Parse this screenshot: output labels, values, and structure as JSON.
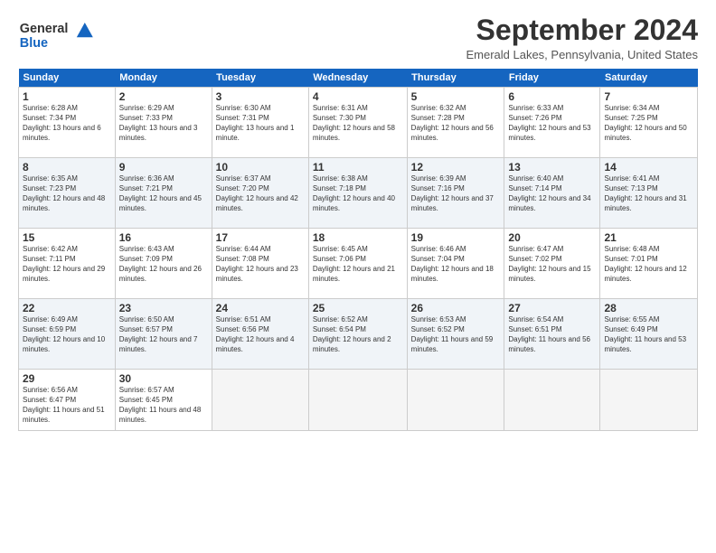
{
  "header": {
    "logo_general": "General",
    "logo_blue": "Blue",
    "title": "September 2024",
    "location": "Emerald Lakes, Pennsylvania, United States"
  },
  "days_of_week": [
    "Sunday",
    "Monday",
    "Tuesday",
    "Wednesday",
    "Thursday",
    "Friday",
    "Saturday"
  ],
  "weeks": [
    [
      {
        "num": "1",
        "sunrise": "6:28 AM",
        "sunset": "7:34 PM",
        "daylight": "13 hours and 6 minutes."
      },
      {
        "num": "2",
        "sunrise": "6:29 AM",
        "sunset": "7:33 PM",
        "daylight": "13 hours and 3 minutes."
      },
      {
        "num": "3",
        "sunrise": "6:30 AM",
        "sunset": "7:31 PM",
        "daylight": "13 hours and 1 minute."
      },
      {
        "num": "4",
        "sunrise": "6:31 AM",
        "sunset": "7:30 PM",
        "daylight": "12 hours and 58 minutes."
      },
      {
        "num": "5",
        "sunrise": "6:32 AM",
        "sunset": "7:28 PM",
        "daylight": "12 hours and 56 minutes."
      },
      {
        "num": "6",
        "sunrise": "6:33 AM",
        "sunset": "7:26 PM",
        "daylight": "12 hours and 53 minutes."
      },
      {
        "num": "7",
        "sunrise": "6:34 AM",
        "sunset": "7:25 PM",
        "daylight": "12 hours and 50 minutes."
      }
    ],
    [
      {
        "num": "8",
        "sunrise": "6:35 AM",
        "sunset": "7:23 PM",
        "daylight": "12 hours and 48 minutes."
      },
      {
        "num": "9",
        "sunrise": "6:36 AM",
        "sunset": "7:21 PM",
        "daylight": "12 hours and 45 minutes."
      },
      {
        "num": "10",
        "sunrise": "6:37 AM",
        "sunset": "7:20 PM",
        "daylight": "12 hours and 42 minutes."
      },
      {
        "num": "11",
        "sunrise": "6:38 AM",
        "sunset": "7:18 PM",
        "daylight": "12 hours and 40 minutes."
      },
      {
        "num": "12",
        "sunrise": "6:39 AM",
        "sunset": "7:16 PM",
        "daylight": "12 hours and 37 minutes."
      },
      {
        "num": "13",
        "sunrise": "6:40 AM",
        "sunset": "7:14 PM",
        "daylight": "12 hours and 34 minutes."
      },
      {
        "num": "14",
        "sunrise": "6:41 AM",
        "sunset": "7:13 PM",
        "daylight": "12 hours and 31 minutes."
      }
    ],
    [
      {
        "num": "15",
        "sunrise": "6:42 AM",
        "sunset": "7:11 PM",
        "daylight": "12 hours and 29 minutes."
      },
      {
        "num": "16",
        "sunrise": "6:43 AM",
        "sunset": "7:09 PM",
        "daylight": "12 hours and 26 minutes."
      },
      {
        "num": "17",
        "sunrise": "6:44 AM",
        "sunset": "7:08 PM",
        "daylight": "12 hours and 23 minutes."
      },
      {
        "num": "18",
        "sunrise": "6:45 AM",
        "sunset": "7:06 PM",
        "daylight": "12 hours and 21 minutes."
      },
      {
        "num": "19",
        "sunrise": "6:46 AM",
        "sunset": "7:04 PM",
        "daylight": "12 hours and 18 minutes."
      },
      {
        "num": "20",
        "sunrise": "6:47 AM",
        "sunset": "7:02 PM",
        "daylight": "12 hours and 15 minutes."
      },
      {
        "num": "21",
        "sunrise": "6:48 AM",
        "sunset": "7:01 PM",
        "daylight": "12 hours and 12 minutes."
      }
    ],
    [
      {
        "num": "22",
        "sunrise": "6:49 AM",
        "sunset": "6:59 PM",
        "daylight": "12 hours and 10 minutes."
      },
      {
        "num": "23",
        "sunrise": "6:50 AM",
        "sunset": "6:57 PM",
        "daylight": "12 hours and 7 minutes."
      },
      {
        "num": "24",
        "sunrise": "6:51 AM",
        "sunset": "6:56 PM",
        "daylight": "12 hours and 4 minutes."
      },
      {
        "num": "25",
        "sunrise": "6:52 AM",
        "sunset": "6:54 PM",
        "daylight": "12 hours and 2 minutes."
      },
      {
        "num": "26",
        "sunrise": "6:53 AM",
        "sunset": "6:52 PM",
        "daylight": "11 hours and 59 minutes."
      },
      {
        "num": "27",
        "sunrise": "6:54 AM",
        "sunset": "6:51 PM",
        "daylight": "11 hours and 56 minutes."
      },
      {
        "num": "28",
        "sunrise": "6:55 AM",
        "sunset": "6:49 PM",
        "daylight": "11 hours and 53 minutes."
      }
    ],
    [
      {
        "num": "29",
        "sunrise": "6:56 AM",
        "sunset": "6:47 PM",
        "daylight": "11 hours and 51 minutes."
      },
      {
        "num": "30",
        "sunrise": "6:57 AM",
        "sunset": "6:45 PM",
        "daylight": "11 hours and 48 minutes."
      },
      null,
      null,
      null,
      null,
      null
    ]
  ]
}
